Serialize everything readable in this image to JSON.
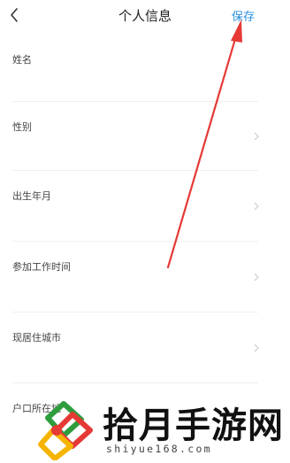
{
  "header": {
    "back_icon": "chevron-left-icon",
    "title": "个人信息",
    "save_label": "保存"
  },
  "fields": [
    {
      "label": "姓名"
    },
    {
      "label": "性别"
    },
    {
      "label": "出生年月"
    },
    {
      "label": "参加工作时间"
    },
    {
      "label": "现居住城市"
    },
    {
      "label": "户口所在地"
    }
  ],
  "colors": {
    "accent": "#2a8fe0",
    "annotation_arrow": "#e53935"
  },
  "watermark": {
    "name": "拾月手游网",
    "url": "shiyue168.com"
  }
}
